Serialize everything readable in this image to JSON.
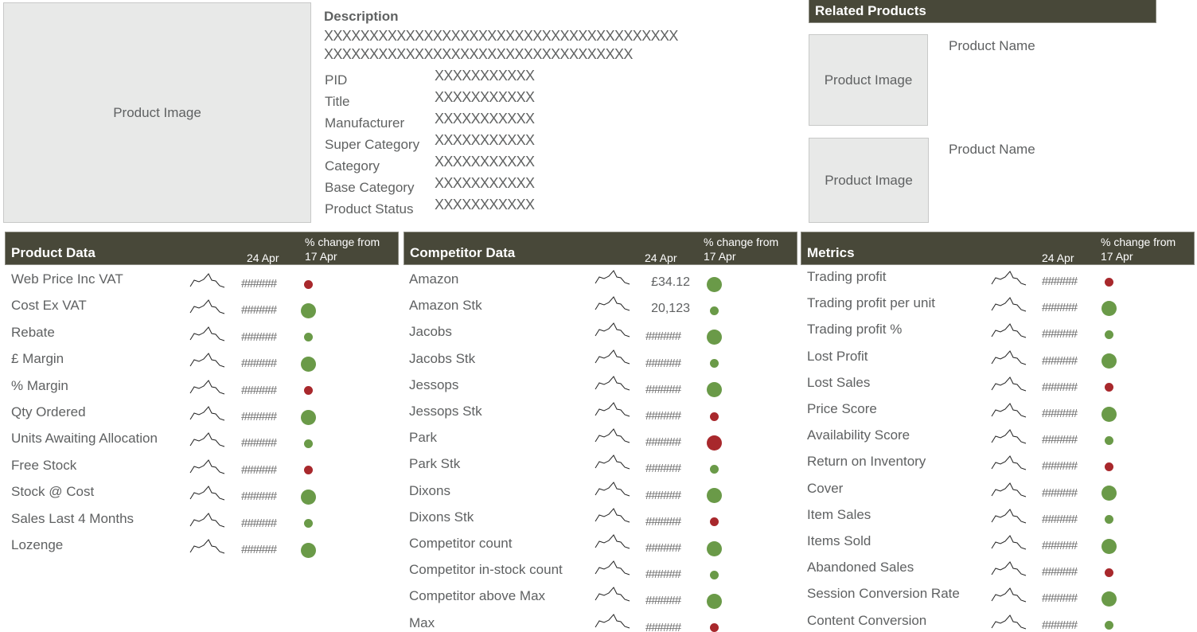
{
  "colors": {
    "header_bg": "#484839",
    "good": "#6a9a48",
    "bad": "#a8282c",
    "placeholder_bg": "#e8e9e8"
  },
  "main_image": {
    "label": "Product Image"
  },
  "description": {
    "title": "Description",
    "lines": [
      "XXXXXXXXXXXXXXXXXXXXXXXXXXXXXXXXXXXXXXX",
      "XXXXXXXXXXXXXXXXXXXXXXXXXXXXXXXXXX"
    ],
    "attributes": [
      {
        "label": "PID",
        "value": "XXXXXXXXXXX"
      },
      {
        "label": "Title",
        "value": "XXXXXXXXXXX"
      },
      {
        "label": "Manufacturer",
        "value": "XXXXXXXXXXX"
      },
      {
        "label": "Super Category",
        "value": "XXXXXXXXXXX"
      },
      {
        "label": "Category",
        "value": "XXXXXXXXXXX"
      },
      {
        "label": "Base Category",
        "value": "XXXXXXXXXXX"
      },
      {
        "label": "Product Status",
        "value": "XXXXXXXXXXX"
      }
    ]
  },
  "related": {
    "title": "Related Products",
    "items": [
      {
        "image_label": "Product Image",
        "name": "Product Name"
      },
      {
        "image_label": "Product Image",
        "name": "Product Name"
      }
    ]
  },
  "panels": [
    {
      "title": "Product Data",
      "date": "24 Apr",
      "change_line1": "% change from",
      "change_line2": "17 Apr",
      "rows": [
        {
          "label": "Web Price Inc VAT",
          "value": "######",
          "status": "bad",
          "size": "small"
        },
        {
          "label": "Cost Ex VAT",
          "value": "######",
          "status": "good",
          "size": "large"
        },
        {
          "label": "Rebate",
          "value": "######",
          "status": "good",
          "size": "small"
        },
        {
          "label": "£ Margin",
          "value": "######",
          "status": "good",
          "size": "large"
        },
        {
          "label": "% Margin",
          "value": "######",
          "status": "bad",
          "size": "small"
        },
        {
          "label": "Qty Ordered",
          "value": "######",
          "status": "good",
          "size": "large"
        },
        {
          "label": "Units Awaiting Allocation",
          "value": "######",
          "status": "good",
          "size": "small"
        },
        {
          "label": "Free Stock",
          "value": "######",
          "status": "bad",
          "size": "small"
        },
        {
          "label": "Stock @ Cost",
          "value": "######",
          "status": "good",
          "size": "large"
        },
        {
          "label": "Sales Last 4 Months",
          "value": "######",
          "status": "good",
          "size": "small"
        },
        {
          "label": "Lozenge",
          "value": "######",
          "status": "good",
          "size": "large"
        }
      ]
    },
    {
      "title": "Competitor Data",
      "date": "24 Apr",
      "change_line1": "% change from",
      "change_line2": "17 Apr",
      "rows": [
        {
          "label": "Amazon",
          "value": "£34.12",
          "status": "good",
          "size": "large"
        },
        {
          "label": "Amazon Stk",
          "value": "20,123",
          "status": "good",
          "size": "small"
        },
        {
          "label": "Jacobs",
          "value": "######",
          "status": "good",
          "size": "large"
        },
        {
          "label": "Jacobs Stk",
          "value": "######",
          "status": "good",
          "size": "small"
        },
        {
          "label": "Jessops",
          "value": "######",
          "status": "good",
          "size": "large"
        },
        {
          "label": "Jessops Stk",
          "value": "######",
          "status": "bad",
          "size": "small"
        },
        {
          "label": "Park",
          "value": "######",
          "status": "bad",
          "size": "large"
        },
        {
          "label": "Park Stk",
          "value": "######",
          "status": "good",
          "size": "small"
        },
        {
          "label": "Dixons",
          "value": "######",
          "status": "good",
          "size": "large"
        },
        {
          "label": "Dixons Stk",
          "value": "######",
          "status": "bad",
          "size": "small"
        },
        {
          "label": "Competitor count",
          "value": "######",
          "status": "good",
          "size": "large"
        },
        {
          "label": "Competitor in-stock count",
          "value": "######",
          "status": "good",
          "size": "small"
        },
        {
          "label": "Competitor above Max",
          "value": "######",
          "status": "good",
          "size": "large"
        },
        {
          "label": "Max",
          "value": "######",
          "status": "bad",
          "size": "small"
        }
      ]
    },
    {
      "title": "Metrics",
      "date": "24 Apr",
      "change_line1": "% change from",
      "change_line2": "17 Apr",
      "rows": [
        {
          "label": "Trading profit",
          "value": "######",
          "status": "bad",
          "size": "small"
        },
        {
          "label": "Trading profit per unit",
          "value": "######",
          "status": "good",
          "size": "large"
        },
        {
          "label": "Trading profit %",
          "value": "######",
          "status": "good",
          "size": "small"
        },
        {
          "label": "Lost Profit",
          "value": "######",
          "status": "good",
          "size": "large"
        },
        {
          "label": "Lost Sales",
          "value": "######",
          "status": "bad",
          "size": "small"
        },
        {
          "label": "Price Score",
          "value": "######",
          "status": "good",
          "size": "large"
        },
        {
          "label": "Availability Score",
          "value": "######",
          "status": "good",
          "size": "small"
        },
        {
          "label": "Return on Inventory",
          "value": "######",
          "status": "bad",
          "size": "small"
        },
        {
          "label": "Cover",
          "value": "######",
          "status": "good",
          "size": "large"
        },
        {
          "label": "Item Sales",
          "value": "######",
          "status": "good",
          "size": "small"
        },
        {
          "label": "Items Sold",
          "value": "######",
          "status": "good",
          "size": "large"
        },
        {
          "label": "Abandoned Sales",
          "value": "######",
          "status": "bad",
          "size": "small"
        },
        {
          "label": "Session Conversion Rate",
          "value": "######",
          "status": "good",
          "size": "large"
        },
        {
          "label": "Content Conversion",
          "value": "######",
          "status": "good",
          "size": "small"
        }
      ]
    }
  ]
}
